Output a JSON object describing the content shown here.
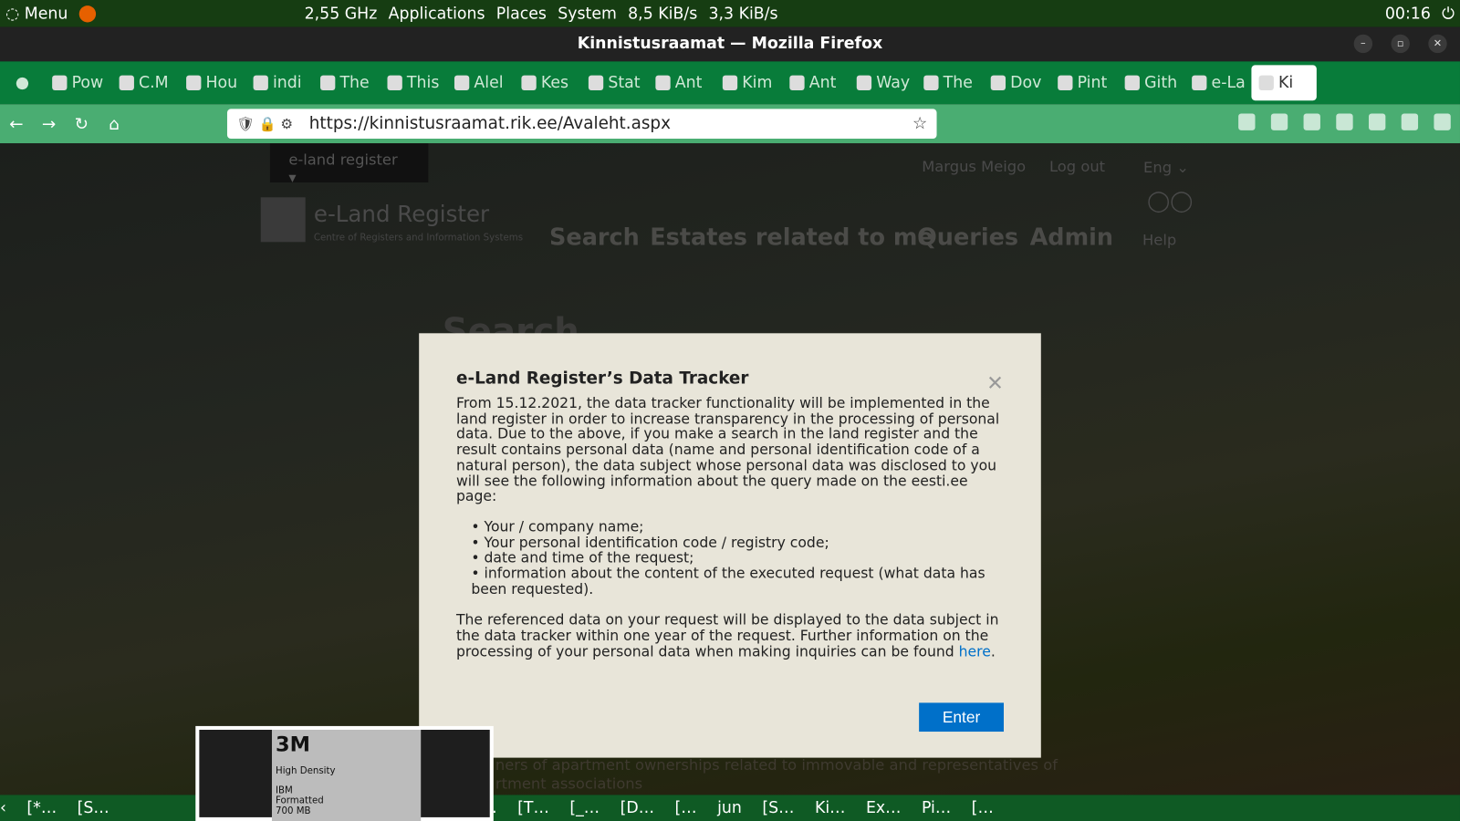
{
  "topbar": {
    "menu": "Menu",
    "cpu": "2,55 GHz",
    "applications": "Applications",
    "places": "Places",
    "system": "System",
    "down": "8,5 KiB/s",
    "up": "3,3 KiB/s",
    "time": "00:16"
  },
  "window": {
    "title": "Kinnistusraamat — Mozilla Firefox"
  },
  "tabs": [
    "Pow",
    "C.M",
    "Hou",
    "indi",
    "The",
    "This",
    "Alel",
    "Kes",
    "Stat",
    "Ant",
    "Kim",
    "Ant",
    "Way",
    "The",
    "Dov",
    "Pint",
    "Gith",
    "e-La",
    "Ki"
  ],
  "nav": {
    "url": "https://kinnistusraamat.rik.ee/Avaleht.aspx"
  },
  "site": {
    "selector": "e-land register",
    "user": "Margus Meigo",
    "logout": "Log out",
    "lang": "Eng",
    "logo": "e-Land Register",
    "logo_sub": "Centre of Registers and Information Systems",
    "menu": [
      "Search",
      "Estates related to me",
      "Queries",
      "Admin"
    ],
    "help": "Help",
    "heading": "Search",
    "footer1": "ners of apartment ownerships related to immovable and representatives of",
    "footer2": "rtment associations"
  },
  "modal": {
    "title": "e-Land Register’s Data Tracker",
    "p1": "From 15.12.2021, the data tracker functionality will be implemented in the land register in order to increase transparency in the processing of personal data. Due to the above, if you make a search in the land register and the result contains personal data (name and personal identification code of a natural person), the data subject whose personal data was disclosed to you will see the following information about the query made on the eesti.ee page:",
    "items": [
      "Your / company name;",
      "Your personal identification code / registry code;",
      "date and time of the request;",
      "information about the content of the executed request (what data has been requested)."
    ],
    "p2": "The referenced data on your request will be displayed to the data subject in the data tracker within one year of the request. Further information on the processing of your personal data when making inquiries can be found ",
    "link": "here",
    "enter": "Enter"
  },
  "floppy": {
    "brand": "3M",
    "density": "High Density",
    "ibm": "IBM",
    "formatted": "Formatted",
    "size": "700 MB"
  },
  "taskbar": [
    "[*…",
    "[S…",
    "[p…",
    "[T…",
    "[_…",
    "[D…",
    "[…",
    "jun",
    "[S…",
    "Ki…",
    "Ex…",
    "Pi…",
    "[…"
  ]
}
